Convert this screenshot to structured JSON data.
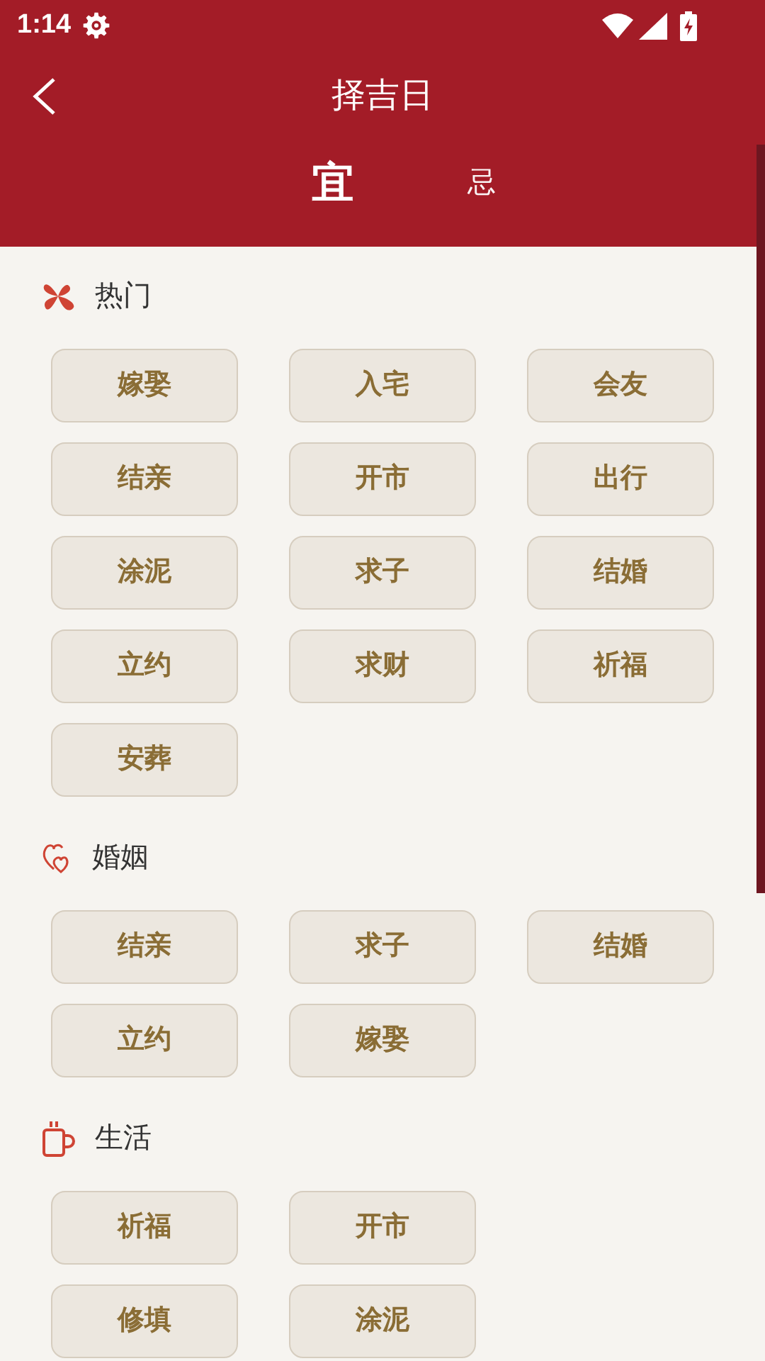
{
  "status_bar": {
    "time": "1:14"
  },
  "header": {
    "title": "择吉日"
  },
  "tabs": [
    {
      "label": "宜",
      "selected": true
    },
    {
      "label": "忌",
      "selected": false
    }
  ],
  "sections": [
    {
      "kind": "hot",
      "title": "热门",
      "items": [
        "嫁娶",
        "入宅",
        "会友",
        "结亲",
        "开市",
        "出行",
        "涂泥",
        "求子",
        "结婚",
        "立约",
        "求财",
        "祈福",
        "安葬"
      ]
    },
    {
      "kind": "marriage",
      "title": "婚姻",
      "items": [
        "结亲",
        "求子",
        "结婚",
        "立约",
        "嫁娶"
      ]
    },
    {
      "kind": "life",
      "title": "生活",
      "rows": [
        [
          "祈福",
          "开市"
        ],
        [
          "修填",
          "涂泥"
        ]
      ]
    }
  ]
}
